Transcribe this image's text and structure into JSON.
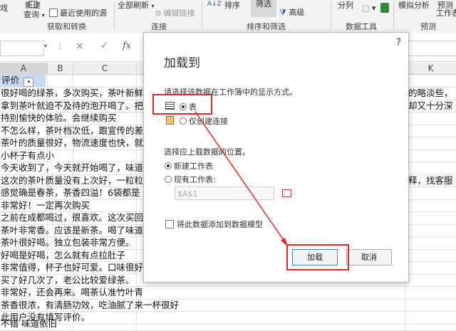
{
  "ribbon": {
    "new_query": "新建",
    "query": "查询",
    "recent_sources": "最近使用的源",
    "refresh_all": "全部刷新",
    "edit_links": "编辑链接",
    "sort": "排序",
    "filter": "筛选",
    "advanced": "高级",
    "split_columns": "分列",
    "what_if": "模拟分析",
    "forecast_sheet": "预测",
    "worksheet": "工作表",
    "left_partial": "戏",
    "group_get_transform": "获取和转换",
    "group_connections": "连接",
    "group_sort_filter": "排序和筛选",
    "group_data_tools": "数据工具",
    "group_forecast": "预测"
  },
  "formula_bar": {
    "cancel_glyph": "×",
    "enter_glyph": "✓",
    "fx_label": "fx"
  },
  "grid": {
    "columns": [
      "A",
      "B",
      "C",
      "K"
    ],
    "filter_header": "评价",
    "rows": [
      {
        "left": "很好喝的绿茶，多次购买，茶叶新鲜",
        "right": "的略淡些，"
      },
      {
        "left": "拿到茶叶就迫不及待的泡开喝了。把",
        "right": "却又十分深"
      },
      {
        "left": "持别愉快的体验。会继续购买",
        "right": ""
      },
      {
        "left": "不怎么样，茶叶档次低，跟宣传的差",
        "right": ""
      },
      {
        "left": "茶叶的质量很好，物流速度也快，就",
        "right": ""
      },
      {
        "left": "小杯子有点小",
        "right": ""
      },
      {
        "left": "今天收到了，今天就开始喝了，味道",
        "right": ""
      },
      {
        "left": "这次的茶叶质量没有上次好，一粒粒",
        "right": "释，找客服"
      },
      {
        "left": "感觉确是春茶，茶香四溢！6袋都是",
        "right": ""
      },
      {
        "left": "非常好！一定再次购买",
        "right": ""
      },
      {
        "left": "之前在成都喝过，很喜欢。这次买回",
        "right": ""
      },
      {
        "left": "茶叶非常香。应该是新茶。喝了味道",
        "right": ""
      },
      {
        "left": "茶叶很好喝。独立包装非常方便。",
        "right": ""
      },
      {
        "left": "好喝是好喝，怎么就有点拉肚子",
        "right": ""
      },
      {
        "left": "非常值得，杯子也好可爱。口味很好",
        "right": ""
      },
      {
        "left": "买了好几次了，老公比较爱绿茶。",
        "right": ""
      },
      {
        "left": "非常好，还会再来。喝茶认准竹叶青",
        "right": ""
      },
      {
        "left": "茶香很浓，有清肠功效，吃油腻了来一杯很好",
        "right": ""
      },
      {
        "left": "此用户没有填写评价。",
        "right": ""
      },
      {
        "left": "不错 味道依旧",
        "right": ""
      }
    ]
  },
  "dialog": {
    "title": "加载到",
    "close_glyph": "?",
    "prompt": "请选择该数据在工作簿中的显示方式。",
    "opt_table": "表",
    "opt_connection_only": "仅创建连接",
    "location_label": "选择应上载数据的位置。",
    "opt_new_sheet": "新建工作表",
    "opt_existing_sheet": "现有工作表:",
    "existing_ref_placeholder": "$A$1",
    "add_to_model": "将此数据添加到数据模型",
    "load_button": "加载",
    "cancel_button": "取消"
  },
  "colors": {
    "annotation_red": "#e52727",
    "selection_blue": "#c7daf2",
    "excel_green": "#1e7145"
  }
}
